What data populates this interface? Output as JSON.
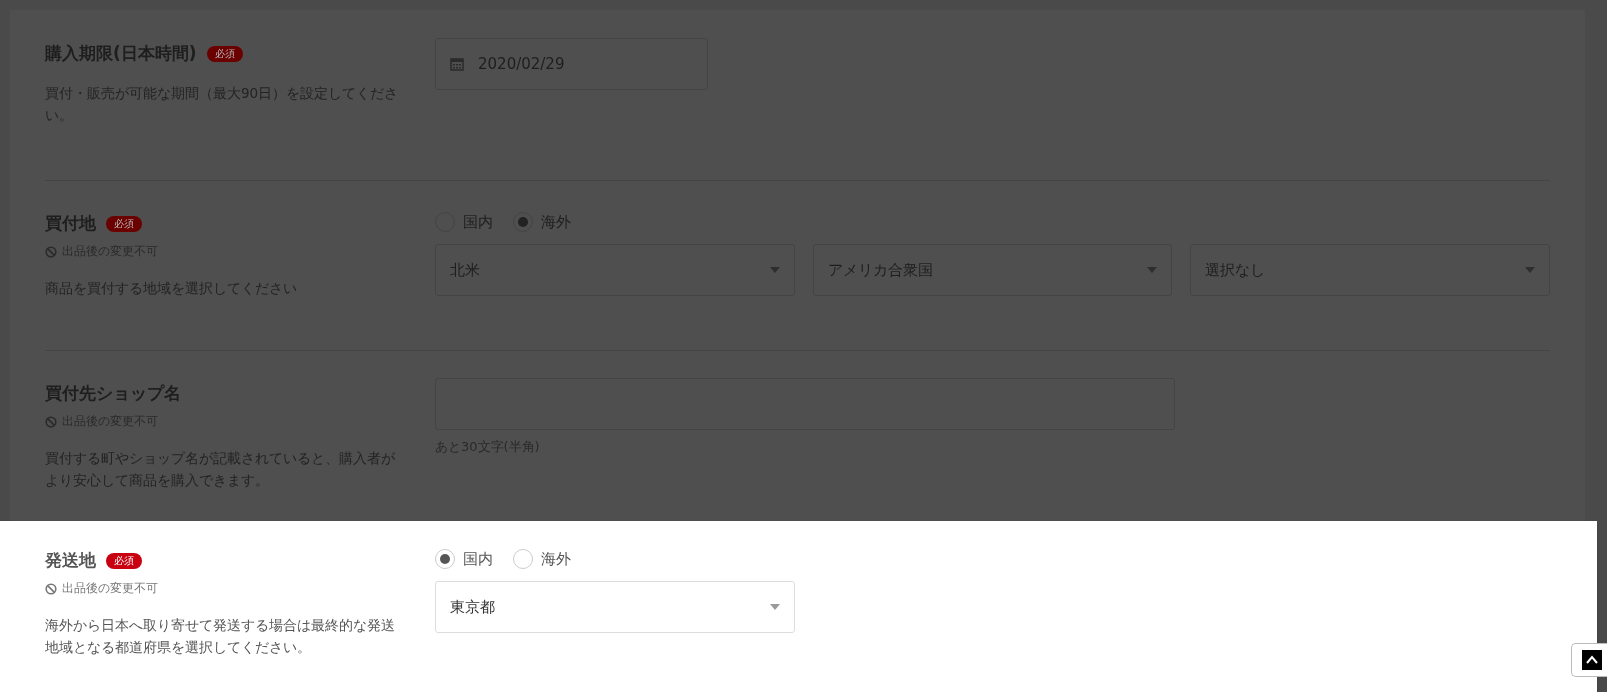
{
  "sections": [
    {
      "title": "購入期限(日本時間)",
      "required": "必須",
      "description": "買付・販売が可能な期間（最大90日）を設定してください。",
      "highlighted": false,
      "controls": [
        {
          "kind": "date",
          "value": "2020/02/29"
        }
      ]
    },
    {
      "title": "買付地",
      "required": "必須",
      "locked_note": "出品後の変更不可",
      "description": "商品を買付する地域を選択してください",
      "highlighted": false,
      "controls": [
        {
          "kind": "radios",
          "options": [
            {
              "label": "国内",
              "selected": false
            },
            {
              "label": "海外",
              "selected": true
            }
          ]
        },
        {
          "kind": "selects",
          "items": [
            {
              "value": "北米"
            },
            {
              "value": "アメリカ合衆国"
            },
            {
              "value": "選択なし"
            }
          ]
        }
      ]
    },
    {
      "title": "買付先ショップ名",
      "locked_note": "出品後の変更不可",
      "description": "買付する町やショップ名が記載されていると、購入者がより安心して商品を購入できます。",
      "highlighted": false,
      "controls": [
        {
          "kind": "text",
          "hint": "あと30文字(半角)"
        }
      ]
    },
    {
      "title": "発送地",
      "required": "必須",
      "locked_note": "出品後の変更不可",
      "description": "海外から日本へ取り寄せて発送する場合は最終的な発送地域となる都道府県を選択してください。",
      "highlighted": true,
      "controls": [
        {
          "kind": "radios",
          "options": [
            {
              "label": "国内",
              "selected": true
            },
            {
              "label": "海外",
              "selected": false
            }
          ]
        },
        {
          "kind": "selects",
          "items": [
            {
              "value": "東京都"
            }
          ]
        }
      ]
    }
  ]
}
